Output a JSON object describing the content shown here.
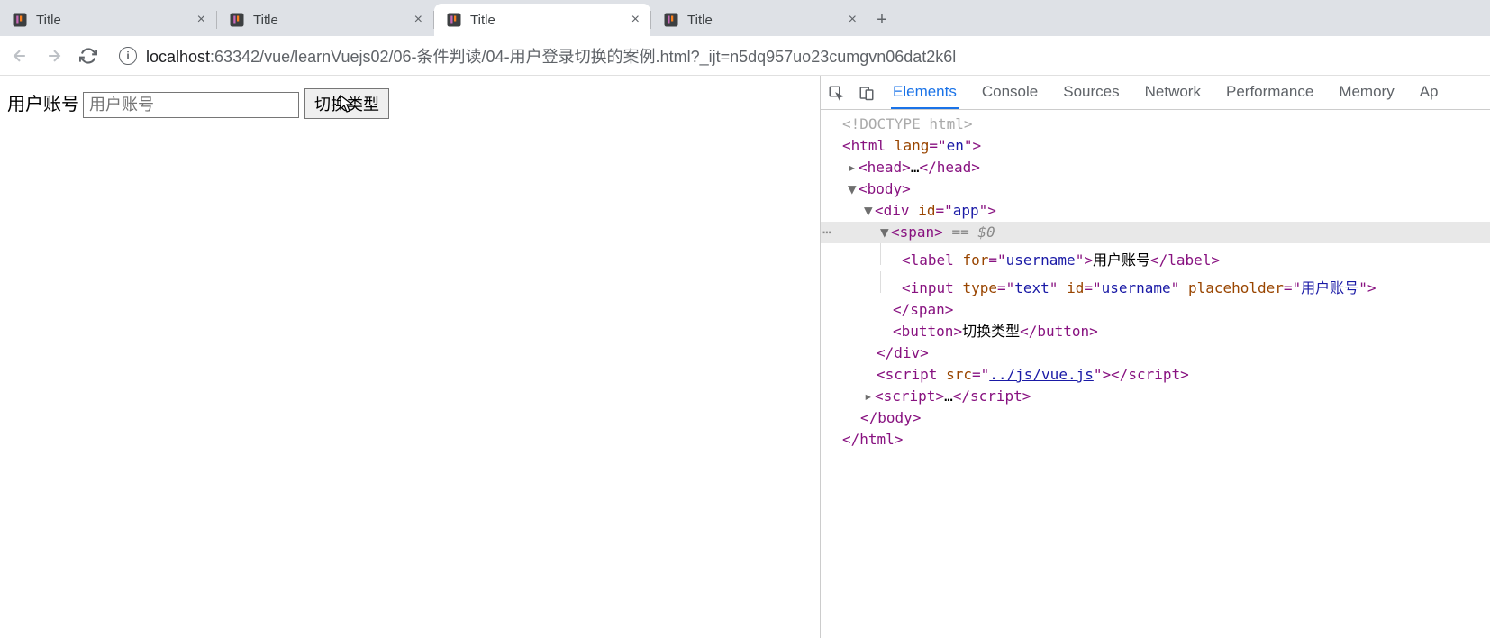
{
  "browser": {
    "tabs": [
      {
        "title": "Title",
        "active": false
      },
      {
        "title": "Title",
        "active": false
      },
      {
        "title": "Title",
        "active": true
      },
      {
        "title": "Title",
        "active": false
      }
    ],
    "url_host": "localhost",
    "url_port_path": ":63342/vue/learnVuejs02/06-条件判读/04-用户登录切换的案例.html?_ijt=n5dq957uo23cumgvn06dat2k6l"
  },
  "page": {
    "label_text": "用户账号",
    "input_placeholder": "用户账号",
    "button_text": "切换类型"
  },
  "devtools": {
    "tabs": [
      "Elements",
      "Console",
      "Sources",
      "Network",
      "Performance",
      "Memory",
      "Ap"
    ],
    "active_tab": "Elements",
    "dom": {
      "doctype": "<!DOCTYPE html>",
      "html_open": "html",
      "html_lang_attr": "lang",
      "html_lang_val": "en",
      "head": "head",
      "head_ellipsis": "…",
      "body": "body",
      "div": "div",
      "div_id_attr": "id",
      "div_id_val": "app",
      "span": "span",
      "selected_suffix": " == $0",
      "label": "label",
      "label_for_attr": "for",
      "label_for_val": "username",
      "label_text": "用户账号",
      "input": "input",
      "input_type_attr": "type",
      "input_type_val": "text",
      "input_id_attr": "id",
      "input_id_val": "username",
      "input_ph_attr": "placeholder",
      "input_ph_val": "用户账号",
      "button": "button",
      "button_text": "切换类型",
      "script": "script",
      "script_src_attr": "src",
      "script_src_val": "../js/vue.js",
      "script2_ellipsis": "…"
    }
  }
}
